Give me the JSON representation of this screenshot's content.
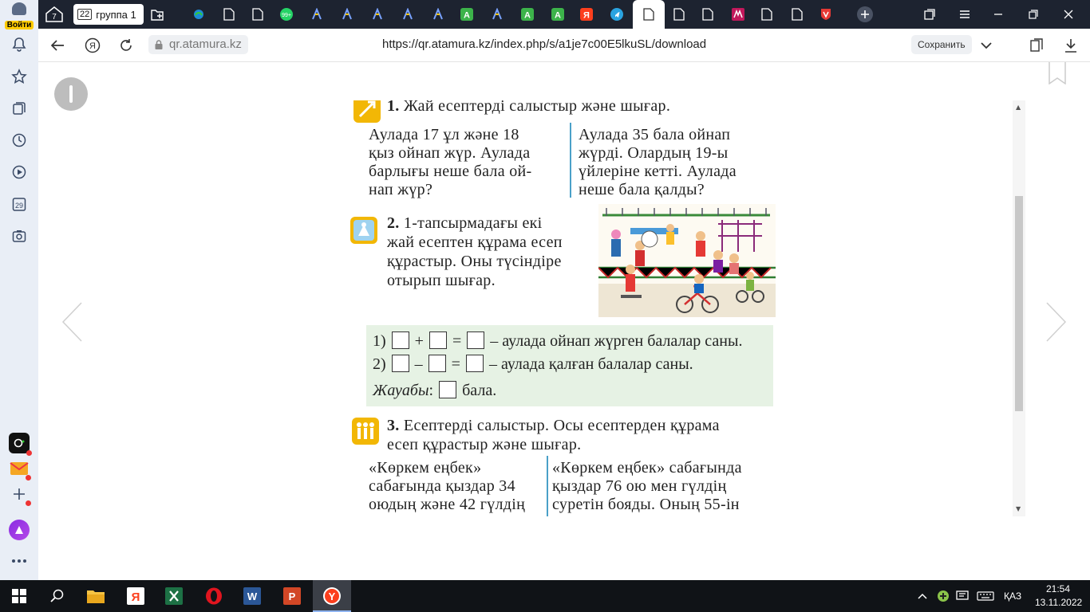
{
  "sidebar": {
    "login_label": "Войти",
    "icons": [
      "bell-icon",
      "star-icon",
      "collections-icon",
      "history-icon",
      "video-icon",
      "calendar-icon",
      "screenshot-icon",
      "alice-icon",
      "mail-icon",
      "add-icon",
      "more-icon"
    ],
    "calendar_day": "29"
  },
  "tabs": {
    "pinned_count": "7",
    "group_count": "22",
    "group_label": "группа 1"
  },
  "addressbar": {
    "domain": "qr.atamura.kz",
    "url": "https://qr.atamura.kz/index.php/s/a1je7c00E5lkuSL/download",
    "save_label": "Сохранить"
  },
  "book": {
    "task1": {
      "number": "1.",
      "title": "Жай есептерді салыстыр және шығар.",
      "left": [
        "Аулада 17 ұл және 18",
        "қыз ойнап жүр. Аулада",
        "барлығы неше бала ой-",
        "нап жүр?"
      ],
      "right": [
        "Аулада 35 бала ойнап",
        "жүрді. Олардың 19-ы",
        "үйлеріне кетті. Аулада",
        "неше бала қалды?"
      ]
    },
    "task2": {
      "number": "2.",
      "lines": [
        "1-тапсырмадағы екі",
        "жай есептен құрама есеп",
        "құрастыр. Оны түсіндіре",
        "отырып шығар."
      ]
    },
    "equations": {
      "eq1_prefix": "1)",
      "eq1_op": "+",
      "eq1_eq": "=",
      "eq1_text": "– аулада ойнап жүрген балалар саны.",
      "eq2_prefix": "2)",
      "eq2_op": "–",
      "eq2_eq": "=",
      "eq2_text": "– аулада қалған балалар саны.",
      "answer_label": "Жауабы",
      "answer_colon": ":",
      "answer_unit": "бала."
    },
    "task3": {
      "number": "3.",
      "lines": [
        "Есептерді салыстыр. Осы есептерден құрама",
        "есеп құрастыр және шығар."
      ],
      "left": [
        "«Көркем еңбек»",
        "сабағында қыздар 34",
        "оюдың және 42 гүлдің"
      ],
      "right": [
        "«Көркем еңбек» сабағында",
        "қыздар 76 ою мен  гүлдің",
        "суретін бояды. Оның 55-ін"
      ]
    }
  },
  "taskbar": {
    "apps": [
      "start-icon",
      "search-icon",
      "explorer-icon",
      "yandex-icon",
      "excel-icon",
      "opera-icon",
      "word-icon",
      "powerpoint-icon",
      "yandex-browser-icon"
    ],
    "lang": "ҚАЗ",
    "time": "21:54",
    "date": "13.11.2022"
  }
}
